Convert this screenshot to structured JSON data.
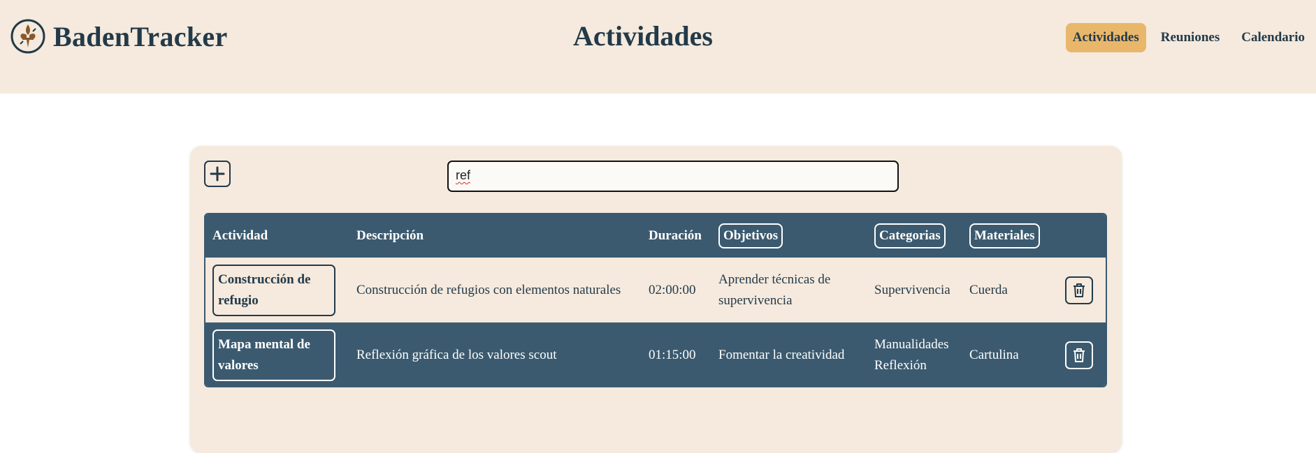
{
  "header": {
    "brand": "BadenTracker",
    "title": "Actividades",
    "nav": [
      "Actividades",
      "Reuniones",
      "Calendario"
    ],
    "active_nav": "Actividades"
  },
  "search": {
    "value": "ref"
  },
  "table": {
    "columns": [
      "Actividad",
      "Descripción",
      "Duración",
      "Objetivos",
      "Categorias",
      "Materiales"
    ],
    "rows": [
      {
        "actividad": "Construcción de refugio",
        "descripcion": "Construcción de refugios con elementos naturales",
        "duracion": "02:00:00",
        "objetivos": "Aprender técnicas de supervivencia",
        "categorias": "Supervivencia",
        "materiales": "Cuerda"
      },
      {
        "actividad": "Mapa mental de valores",
        "descripcion": "Reflexión gráfica de los valores scout",
        "duracion": "01:15:00",
        "objetivos": "Fomentar la creatividad",
        "categorias": "Manualidades Reflexión",
        "materiales": "Cartulina"
      }
    ]
  },
  "colors": {
    "header_bg": "#f5eadd",
    "accent": "#e9b76b",
    "table_dark": "#3b5a6f",
    "text_dark": "#233a4a"
  },
  "icons": [
    "compass-fleur-de-lis-logo-icon",
    "plus-icon",
    "trash-icon"
  ]
}
